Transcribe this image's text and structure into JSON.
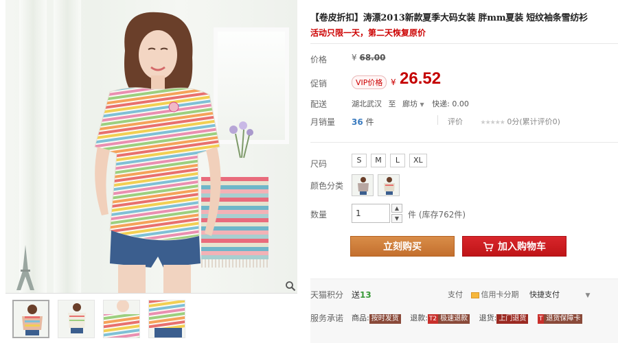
{
  "product": {
    "title": "【卷皮折扣】涛漂2013新款夏季大码女装 胖mm夏装 短纹袖条雪纺衫",
    "subtitle": "活动只限一天，第二天恢复原价"
  },
  "price": {
    "label": "价格",
    "original_currency": "¥",
    "original_value": "68.00",
    "promo_label": "促销",
    "vip_badge": "VIP价格",
    "currency": "¥",
    "value": "26.52"
  },
  "shipping": {
    "label": "配送",
    "from": "湖北武汉",
    "to_word": "至",
    "to": "廊坊",
    "fee": "快递: 0.00"
  },
  "sales": {
    "label": "月销量",
    "count": "36",
    "unit": "件",
    "review_label": "评价",
    "stars": "★★★★★",
    "review_text": "0分(累计评价0)"
  },
  "options": {
    "size_label": "尺码",
    "sizes": [
      "S",
      "M",
      "L",
      "XL"
    ],
    "color_label": "颜色分类"
  },
  "quantity": {
    "label": "数量",
    "value": "1",
    "stock": "件 (库存762件)"
  },
  "buttons": {
    "buy": "立刻购买",
    "cart": "加入购物车"
  },
  "footer": {
    "points_label": "天猫积分",
    "points_prefix": "送",
    "points_value": "13",
    "pay_label": "支付",
    "pay_card": "信用卡分期",
    "pay_fast": "快捷支付",
    "service_label": "服务承诺",
    "service_items": [
      {
        "prefix": "商品:",
        "tag": "按时发货"
      },
      {
        "prefix": "退款:",
        "mark": "T2",
        "tag": "极速退款"
      },
      {
        "prefix": "退货:",
        "tag": "上门退货"
      },
      {
        "mark": "T",
        "tag": "退货保障卡"
      }
    ]
  },
  "colors": {
    "price_red": "#c40000",
    "buy_orange": "#c87534",
    "cart_red": "#cc1a1e"
  },
  "icons": [
    "zoom-icon",
    "cart-icon",
    "credit-card-icon",
    "chevron-down-icon",
    "stepper-up-icon",
    "stepper-down-icon"
  ]
}
